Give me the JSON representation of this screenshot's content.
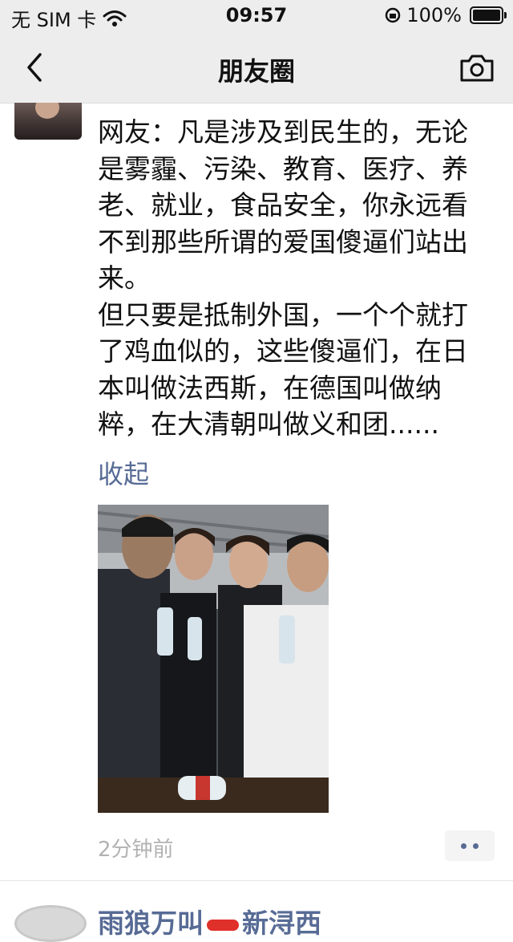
{
  "status_bar": {
    "carrier": "无 SIM 卡",
    "time": "09:57",
    "battery": "100%"
  },
  "nav": {
    "title": "朋友圈"
  },
  "post": {
    "paragraph1": "网友：凡是涉及到民生的，无论是雾霾、污染、教育、医疗、养老、就业，食品安全，你永远看不到那些所谓的爱国傻逼们站出来。",
    "paragraph2": "但只要是抵制外国，一个个就打了鸡血似的，这些傻逼们，在日本叫做法西斯，在德国叫做纳粹，在大清朝叫做义和团......",
    "collapse_label": "收起",
    "timestamp": "2分钟前"
  },
  "next_post": {
    "name_part1": "雨狼万叫",
    "name_part2": "新浔西"
  },
  "colors": {
    "link": "#576b95",
    "bar_bg": "#ededed",
    "muted": "#b2b2b2"
  }
}
